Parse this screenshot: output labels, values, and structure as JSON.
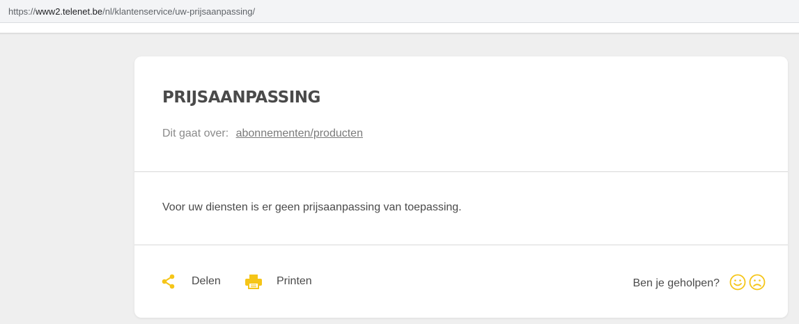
{
  "browser": {
    "url_scheme": "https://",
    "url_host": "www2.telenet.be",
    "url_path": "/nl/klantenservice/uw-prijsaanpassing/"
  },
  "article": {
    "title": "PRIJSAANPASSING",
    "topic_label": "Dit gaat over:",
    "topic_link": "abonnementen/producten",
    "body": "Voor uw diensten is er geen prijsaanpassing van toepassing."
  },
  "actions": {
    "share_label": "Delen",
    "print_label": "Printen",
    "share_icon": "share-icon",
    "print_icon": "printer-icon"
  },
  "feedback": {
    "question": "Ben je geholpen?",
    "positive_icon": "smiley-happy-icon",
    "negative_icon": "smiley-sad-icon"
  },
  "colors": {
    "accent": "#f5c518",
    "text": "#4a4a4a",
    "muted": "#8a8a8a"
  }
}
